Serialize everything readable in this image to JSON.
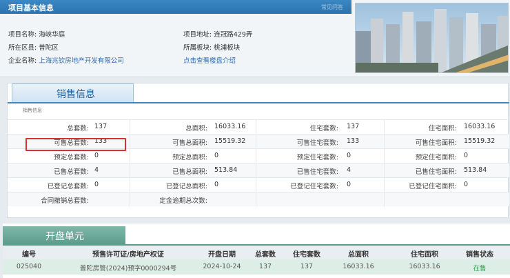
{
  "info": {
    "title": "项目基本信息",
    "link": "常见问答",
    "name_label": "项目名称:",
    "name": "海峡华庭",
    "district_label": "所在区县:",
    "district": "普陀区",
    "company_label": "企业名称:",
    "company": "上海兆钦房地产开发有限公司",
    "address_label": "项目地址:",
    "address": "连冠路429弄",
    "block_label": "所属板块:",
    "block": "桃浦板块",
    "intro_link": "点击查看楼盘介绍"
  },
  "sales": {
    "tab": "销售信息",
    "sub": "销售信息",
    "rows": [
      [
        [
          "总套数:",
          "137"
        ],
        [
          "总面积:",
          "16033.16"
        ],
        [
          "住宅套数:",
          "137"
        ],
        [
          "住宅面积:",
          "16033.16"
        ]
      ],
      [
        [
          "可售总套数:",
          "133"
        ],
        [
          "可售总面积:",
          "15519.32"
        ],
        [
          "可售住宅套数:",
          "133"
        ],
        [
          "可售住宅面积:",
          "15519.32"
        ]
      ],
      [
        [
          "预定总套数:",
          "0"
        ],
        [
          "预定总面积:",
          "0"
        ],
        [
          "预定住宅套数:",
          "0"
        ],
        [
          "预定住宅面积:",
          "0"
        ]
      ],
      [
        [
          "已售总套数:",
          "4"
        ],
        [
          "已售总面积:",
          "513.84"
        ],
        [
          "已售住宅套数:",
          "4"
        ],
        [
          "已售住宅面积:",
          "513.84"
        ]
      ],
      [
        [
          "已登记总套数:",
          "0"
        ],
        [
          "已登记总面积:",
          "0"
        ],
        [
          "已登记住宅套数:",
          "0"
        ],
        [
          "已登记住宅面积:",
          "0"
        ]
      ],
      [
        [
          "合同撤销总套数:",
          ""
        ],
        [
          "定金逾期总次数:",
          ""
        ],
        [
          "",
          ""
        ],
        [
          "",
          ""
        ]
      ]
    ],
    "highlight_color": "#d63030"
  },
  "opening": {
    "tab": "开盘单元",
    "headers": [
      "编号",
      "预售许可证/房地产权证",
      "开盘日期",
      "总套数",
      "住宅套数",
      "总面积",
      "住宅面积",
      "销售状态"
    ],
    "row": [
      "025040",
      "普陀房管(2024)预字0000294号",
      "2024-10-24",
      "137",
      "137",
      "16033.16",
      "16033.16",
      "在售"
    ],
    "status_color": "#2e9a4a"
  },
  "colors": {
    "accent": "#3a88c5",
    "open_accent": "#5e9c8c"
  }
}
